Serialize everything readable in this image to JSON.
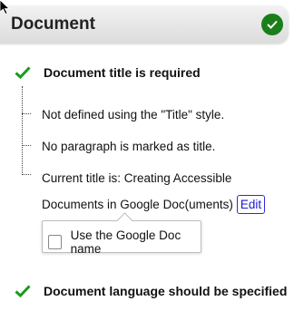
{
  "panel": {
    "title": "Document",
    "status_icon": "check-circle-icon",
    "status_color": "#1a7f1a"
  },
  "rules": [
    {
      "label": "Document title is required",
      "icon": "check-icon",
      "details": [
        "Not defined using the \"Title\" style.",
        "No paragraph is marked as title.",
        "Current title is: Creating Accessible"
      ],
      "title_continuation": "Documents in Google Doc(uments)",
      "edit_label": "Edit",
      "option_label": "Use the Google Doc name"
    },
    {
      "label": "Document language should be specified",
      "icon": "check-icon"
    }
  ],
  "colors": {
    "check_green": "#1a9a1a",
    "link_blue": "#1a1ad0"
  }
}
